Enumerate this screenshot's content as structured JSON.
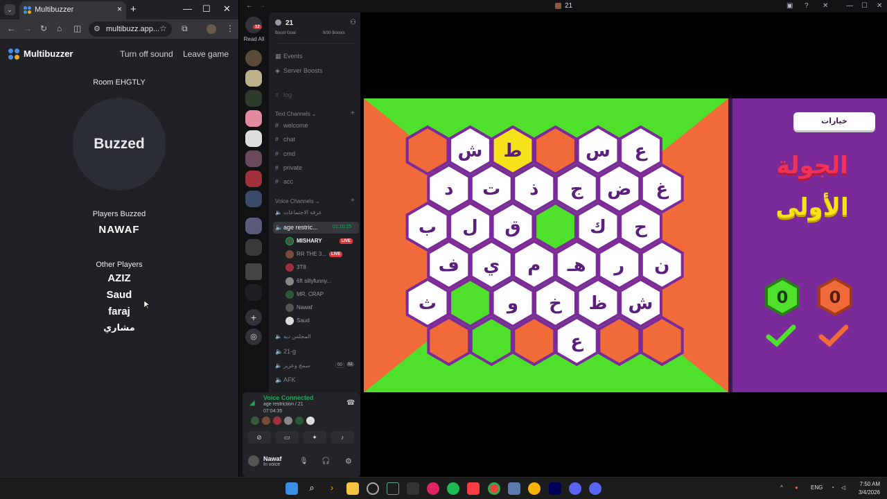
{
  "chrome": {
    "tab_title": "Multibuzzer",
    "url": "multibuzz.app...",
    "new_tab": "+",
    "tab_close": "×"
  },
  "multibuzzer": {
    "app_title": "Multibuzzer",
    "sound_link": "Turn off sound",
    "leave_link": "Leave game",
    "room": "Room EHGTLY",
    "buzz_state": "Buzzed",
    "players_buzzed_label": "Players Buzzed",
    "buzzed_player": "NAWAF",
    "other_players_label": "Other Players",
    "other_players": [
      "AZIZ",
      "Saud",
      "faraj",
      "مشاري"
    ]
  },
  "discord": {
    "title": "21",
    "server_name": "21",
    "read_all": "Read All",
    "mention_badge": "12",
    "boost_goal": "Boost Goal",
    "boost_progress": "9/30 Boosts",
    "events": "Events",
    "server_boosts": "Server Boosts",
    "muted_channel": "log",
    "text_category": "Text Channels",
    "text_channels": [
      "welcome",
      "chat",
      "cmd",
      "private",
      "acc"
    ],
    "voice_category": "Voice Channels",
    "meeting_room": "غرفة الاجتماعات",
    "active_voice": "age restric...",
    "active_voice_time": "01:10:25",
    "voice_users": [
      {
        "name": "MISHARY",
        "live": "LIVE"
      },
      {
        "name": "RR THE 3...",
        "live": "LIVE"
      },
      {
        "name": "3T8",
        "live": ""
      },
      {
        "name": "6ft sillyfunny...",
        "live": ""
      },
      {
        "name": "MR. CRAP",
        "live": ""
      },
      {
        "name": "Nawaf",
        "live": ""
      },
      {
        "name": "Saud",
        "live": ""
      }
    ],
    "voice_channels_after": [
      "المجلس ديه",
      "21-g",
      "سمج وعزيز",
      "AFK"
    ],
    "counter_a": "00",
    "counter_b": "02",
    "voice_connected": "Voice Connected",
    "voice_location": "age restriction / 21",
    "voice_duration": "07:04:35",
    "me_name": "Nawaf",
    "me_status": "In voice"
  },
  "game": {
    "options_button": "خيارات",
    "round_title_line1": "الجولة",
    "round_title_line2": "الأولى",
    "score_green": "0",
    "score_orange": "0",
    "colors": {
      "green": "#4ee02a",
      "orange": "#f06a3a",
      "purple": "#7b2a9a",
      "yellow": "#f5e21b",
      "white": "#ffffff"
    },
    "hex_rows": [
      [
        "orange",
        "ش",
        "ط*",
        "orange",
        "س",
        "ع"
      ],
      [
        "د",
        "ت",
        "ذ",
        "ج",
        "ض",
        "غ"
      ],
      [
        "ب",
        "ل",
        "ق",
        "green",
        "ك",
        "ح"
      ],
      [
        "ف",
        "ي",
        "م",
        "هـ",
        "ر",
        "ن"
      ],
      [
        "ث",
        "green",
        "و",
        "خ",
        "ظ",
        "ش"
      ],
      [
        "orange",
        "green",
        "orange",
        "ع",
        "orange",
        "orange"
      ]
    ]
  },
  "taskbar": {
    "lang": "ENG",
    "time": "7:50 AM",
    "date": "3/4/2026"
  }
}
